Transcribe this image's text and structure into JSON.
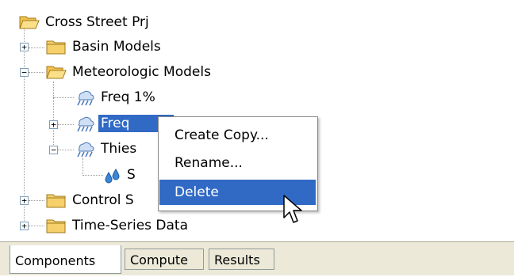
{
  "tree": {
    "root": {
      "label": "Cross Street Prj",
      "icon": "folder-open-icon"
    },
    "items": [
      {
        "label": "Basin Models",
        "icon": "folder-icon",
        "expander": "+"
      },
      {
        "label": "Meteorologic Models",
        "icon": "folder-open-icon",
        "expander": "−"
      },
      {
        "label": "Freq 1%",
        "icon": "rain-cloud-icon"
      },
      {
        "label": "Freq",
        "icon": "rain-cloud-icon",
        "expander": "+",
        "selected": true
      },
      {
        "label": "Thies",
        "icon": "rain-cloud-icon",
        "expander": "−"
      },
      {
        "label": "S",
        "icon": "water-drops-icon"
      },
      {
        "label": "Control S",
        "icon": "folder-icon",
        "expander": "+"
      },
      {
        "label": "Time-Series Data",
        "icon": "folder-icon",
        "expander": "+"
      }
    ]
  },
  "context_menu": {
    "items": [
      {
        "label": "Create Copy..."
      },
      {
        "label": "Rename..."
      },
      {
        "label": "Delete",
        "highlighted": true
      }
    ]
  },
  "tabs": [
    {
      "label": "Components",
      "active": true
    },
    {
      "label": "Compute"
    },
    {
      "label": "Results"
    }
  ],
  "colors": {
    "selection": "#316ac5",
    "folder": "#f5d06b",
    "rain_cloud": "#4a78b8"
  }
}
